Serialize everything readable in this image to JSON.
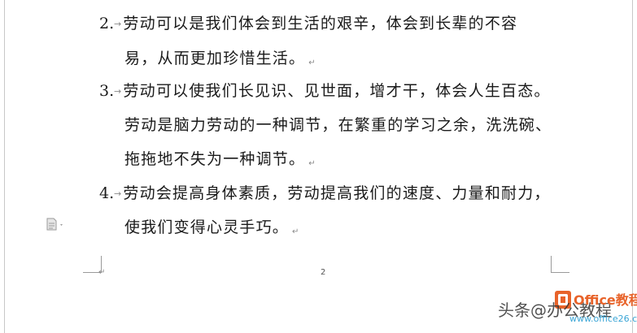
{
  "document": {
    "items": [
      {
        "number": "2.",
        "lines": [
          "劳动可以是我们体会到生活的艰辛，体会到长辈的不容",
          "易，从而更加珍惜生活。"
        ]
      },
      {
        "number": "3.",
        "lines": [
          "劳动可以使我们长见识、见世面，增才干，体会人生百态。",
          "劳动是脑力劳动的一种调节，在繁重的学习之余，洗洗碗、",
          "拖拖地不失为一种调节。"
        ]
      },
      {
        "number": "4.",
        "lines": [
          "劳动会提高身体素质，劳动提高我们的速度、力量和耐力，",
          "使我们变得心灵手巧。"
        ]
      }
    ],
    "tab_glyph": "→",
    "paragraph_mark": "↵",
    "page_number": "2"
  },
  "watermark": {
    "author": "头条@办公教程",
    "brand": "Office教程网",
    "site": "www.office26.com",
    "brand_color": "#e8632a",
    "site_color": "#3aa5d6"
  },
  "icons": {
    "comment": "document-comment-icon"
  }
}
